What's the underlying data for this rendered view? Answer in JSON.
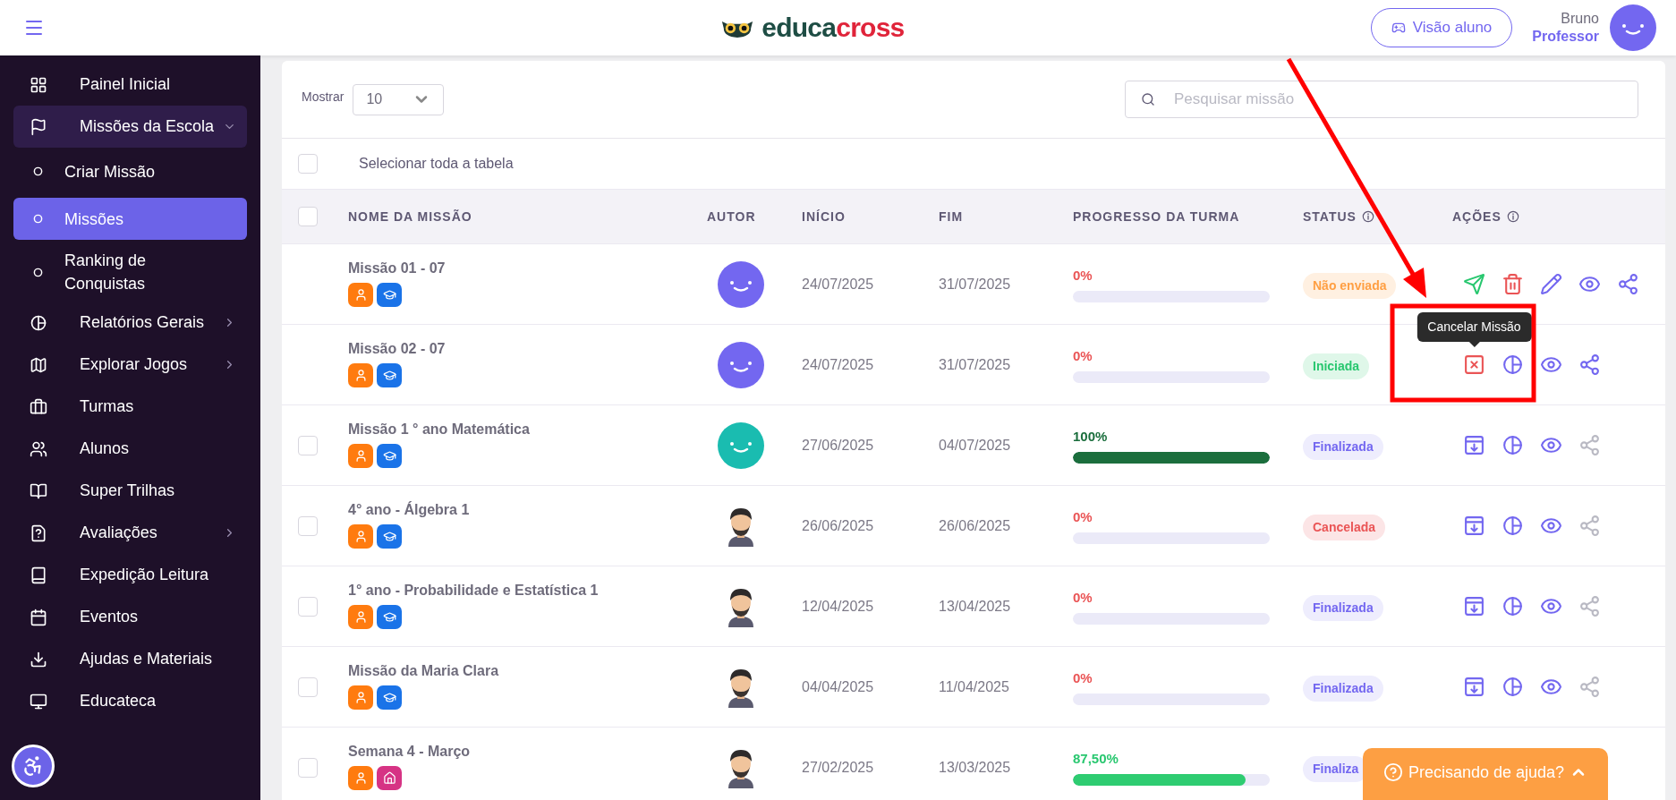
{
  "header": {
    "logo_parts": [
      "educa",
      "cross"
    ],
    "student_view_button": "Visão aluno",
    "user": {
      "name": "Bruno",
      "role": "Professor"
    }
  },
  "sidebar": {
    "items": [
      {
        "kind": "link",
        "label": "Painel Inicial",
        "selected": false
      },
      {
        "kind": "group",
        "label": "Missões da Escola",
        "selected": false,
        "expanded": true,
        "children": [
          {
            "label": "Criar Missão",
            "selected": false
          },
          {
            "label": "Missões",
            "selected": true
          },
          {
            "label": "Ranking de Conquistas",
            "selected": false
          }
        ]
      },
      {
        "kind": "group",
        "label": "Relatórios Gerais",
        "selected": false,
        "expanded": false
      },
      {
        "kind": "group",
        "label": "Explorar Jogos",
        "selected": false,
        "expanded": false
      },
      {
        "kind": "link",
        "label": "Turmas",
        "selected": false
      },
      {
        "kind": "link",
        "label": "Alunos",
        "selected": false
      },
      {
        "kind": "link",
        "label": "Super Trilhas",
        "selected": false
      },
      {
        "kind": "group",
        "label": "Avaliações",
        "selected": false,
        "expanded": false
      },
      {
        "kind": "link",
        "label": "Expedição Leitura",
        "selected": false
      },
      {
        "kind": "link",
        "label": "Eventos",
        "selected": false
      },
      {
        "kind": "link",
        "label": "Ajudas e Materiais",
        "selected": false
      },
      {
        "kind": "link",
        "label": "Educateca",
        "selected": false
      }
    ]
  },
  "controls": {
    "show_label": "Mostrar",
    "page_size": "10",
    "search": {
      "placeholder": "Pesquisar missão"
    },
    "select_all": {
      "label": "Selecionar toda a tabela",
      "checked": false
    }
  },
  "table": {
    "header_checked": false,
    "columns": [
      "NOME DA MISSÃO",
      "AUTOR",
      "INÍCIO",
      "FIM",
      "PROGRESSO DA TURMA",
      "STATUS",
      "AÇÕES"
    ],
    "rows": [
      {
        "name": "Missão 01 - 07",
        "tags": [
          {
            "kind": "student"
          },
          {
            "kind": "class"
          }
        ],
        "author": {
          "kind": "smiley",
          "color": "#7367f0"
        },
        "start": "24/07/2025",
        "end": "31/07/2025",
        "progress": "0%",
        "level": 0,
        "status": {
          "text": "Não enviada",
          "kind": "not_sent"
        },
        "actions": [
          {
            "kind": "send",
            "disabled": false
          },
          {
            "kind": "trash",
            "disabled": false
          },
          {
            "kind": "edit",
            "disabled": false
          },
          {
            "kind": "view",
            "disabled": false
          },
          {
            "kind": "share",
            "disabled": false
          }
        ]
      },
      {
        "name": "Missão 02 - 07",
        "tags": [
          {
            "kind": "student"
          },
          {
            "kind": "class"
          }
        ],
        "author": {
          "kind": "smiley",
          "color": "#7367f0"
        },
        "start": "24/07/2025",
        "end": "31/07/2025",
        "progress": "0%",
        "level": 0,
        "status": {
          "text": "Iniciada",
          "kind": "started"
        },
        "actions": [
          {
            "kind": "cancel",
            "disabled": false,
            "tooltip": "Cancelar Missão"
          },
          {
            "kind": "report",
            "disabled": false
          },
          {
            "kind": "view",
            "disabled": false
          },
          {
            "kind": "share",
            "disabled": false
          }
        ]
      },
      {
        "checked": false,
        "name": "Missão 1 ° ano Matemática",
        "tags": [
          {
            "kind": "student"
          },
          {
            "kind": "class"
          }
        ],
        "author": {
          "kind": "smiley",
          "color": "#1abcb0"
        },
        "start": "27/06/2025",
        "end": "04/07/2025",
        "progress": "100%",
        "level": 1,
        "status": {
          "text": "Finalizada",
          "kind": "finished"
        },
        "actions": [
          {
            "kind": "archive",
            "disabled": false
          },
          {
            "kind": "report",
            "disabled": false
          },
          {
            "kind": "view",
            "disabled": false
          },
          {
            "kind": "share",
            "disabled": true
          }
        ]
      },
      {
        "checked": false,
        "name": "4° ano - Álgebra 1",
        "tags": [
          {
            "kind": "student"
          },
          {
            "kind": "class"
          }
        ],
        "author": {
          "kind": "figure"
        },
        "start": "26/06/2025",
        "end": "26/06/2025",
        "progress": "0%",
        "level": 0,
        "status": {
          "text": "Cancelada",
          "kind": "canceled"
        },
        "actions": [
          {
            "kind": "archive",
            "disabled": false
          },
          {
            "kind": "report",
            "disabled": false
          },
          {
            "kind": "view",
            "disabled": false
          },
          {
            "kind": "share",
            "disabled": true
          }
        ]
      },
      {
        "checked": false,
        "name": "1° ano - Probabilidade e Estatística 1",
        "tags": [
          {
            "kind": "student"
          },
          {
            "kind": "class"
          }
        ],
        "author": {
          "kind": "figure"
        },
        "start": "12/04/2025",
        "end": "13/04/2025",
        "progress": "0%",
        "level": 0,
        "status": {
          "text": "Finalizada",
          "kind": "finished"
        },
        "actions": [
          {
            "kind": "archive",
            "disabled": false
          },
          {
            "kind": "report",
            "disabled": false
          },
          {
            "kind": "view",
            "disabled": false
          },
          {
            "kind": "share",
            "disabled": true
          }
        ]
      },
      {
        "checked": false,
        "name": "Missão da Maria Clara",
        "tags": [
          {
            "kind": "student"
          },
          {
            "kind": "class"
          }
        ],
        "author": {
          "kind": "figure"
        },
        "start": "04/04/2025",
        "end": "11/04/2025",
        "progress": "0%",
        "level": 0,
        "status": {
          "text": "Finalizada",
          "kind": "finished"
        },
        "actions": [
          {
            "kind": "archive",
            "disabled": false
          },
          {
            "kind": "report",
            "disabled": false
          },
          {
            "kind": "view",
            "disabled": false
          },
          {
            "kind": "share",
            "disabled": true
          }
        ]
      },
      {
        "checked": false,
        "name": "Semana 4 - Março",
        "tags": [
          {
            "kind": "student"
          },
          {
            "kind": "home"
          }
        ],
        "author": {
          "kind": "figure"
        },
        "start": "27/02/2025",
        "end": "13/03/2025",
        "progress": "87,50%",
        "level": 0.875,
        "status": {
          "text": "Finaliza",
          "kind": "finished"
        }
      }
    ]
  },
  "help_button": "Precisando de ajuda?"
}
